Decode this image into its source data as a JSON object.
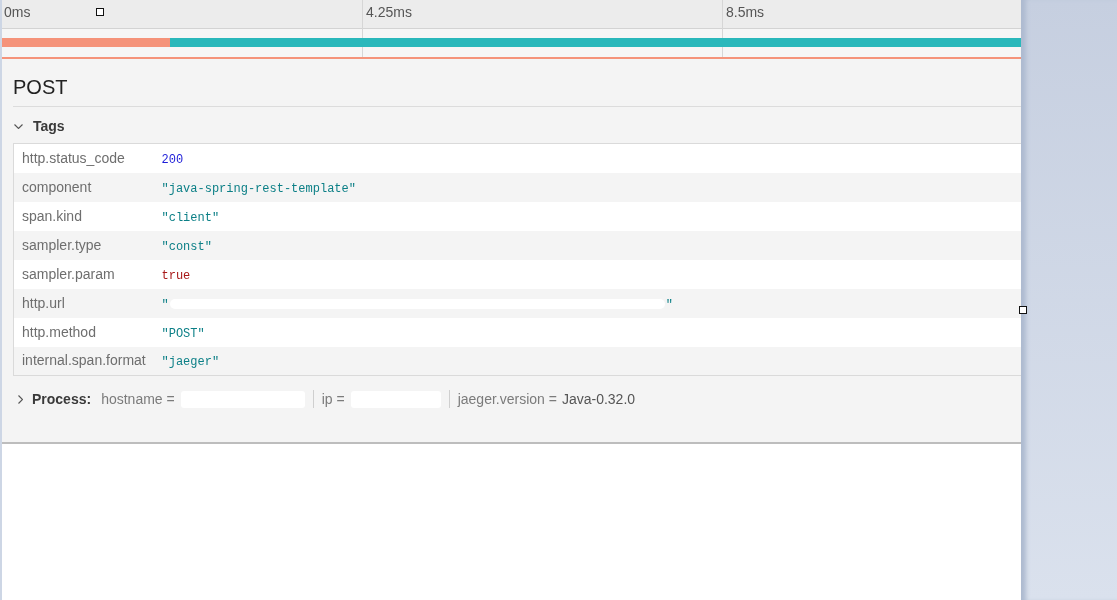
{
  "timeline": {
    "ticks": [
      "0ms",
      "4.25ms",
      "8.5ms"
    ],
    "span_bar": [
      {
        "color": "#f5937a",
        "level": 0.165
      },
      {
        "color": "#2ab8bb",
        "level": 0.835
      }
    ]
  },
  "span": {
    "title": "POST",
    "tags": {
      "label": "Tags",
      "expanded": true,
      "rows": [
        {
          "key": "http.status_code",
          "kind": "number",
          "value": "200",
          "redacted": false
        },
        {
          "key": "component",
          "kind": "string",
          "value": "\"java-spring-rest-template\"",
          "redacted": false
        },
        {
          "key": "span.kind",
          "kind": "string",
          "value": "\"client\"",
          "redacted": false
        },
        {
          "key": "sampler.type",
          "kind": "string",
          "value": "\"const\"",
          "redacted": false
        },
        {
          "key": "sampler.param",
          "kind": "boolean",
          "value": "true",
          "redacted": false
        },
        {
          "key": "http.url",
          "kind": "string",
          "value_before": "\"",
          "value_after": "\"",
          "redacted": true
        },
        {
          "key": "http.method",
          "kind": "string",
          "value": "\"POST\"",
          "redacted": false
        },
        {
          "key": "internal.span.format",
          "kind": "string",
          "value": "\"jaeger\"",
          "redacted": false
        }
      ]
    },
    "process": {
      "label": "Process:",
      "expanded": false,
      "items": [
        {
          "key": "hostname =",
          "redacted": true
        },
        {
          "key": "ip =",
          "redacted": true
        },
        {
          "key": "jaeger.version =",
          "value": "Java-0.32.0",
          "redacted": false
        }
      ]
    }
  }
}
